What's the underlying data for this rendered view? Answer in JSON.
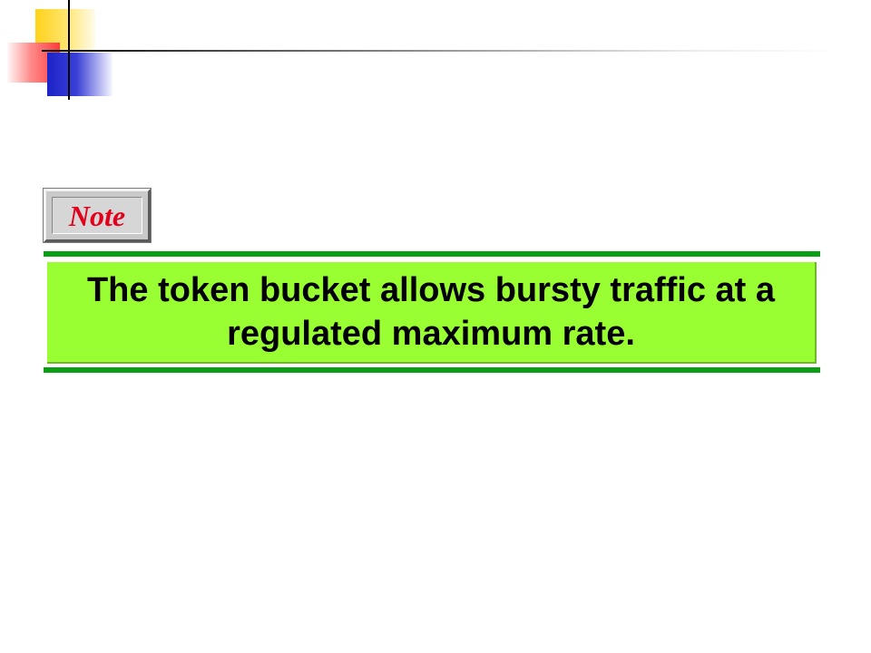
{
  "slide": {
    "note_label": "Note",
    "statement": "The token bucket allows bursty traffic at a regulated maximum rate."
  },
  "colors": {
    "note_text": "#e3001b",
    "rule_green": "#0a9e14",
    "box_fill": "#99ff33",
    "logo_yellow": "#ffd21a",
    "logo_red": "#ff3b3b",
    "logo_blue": "#1c23c8"
  }
}
